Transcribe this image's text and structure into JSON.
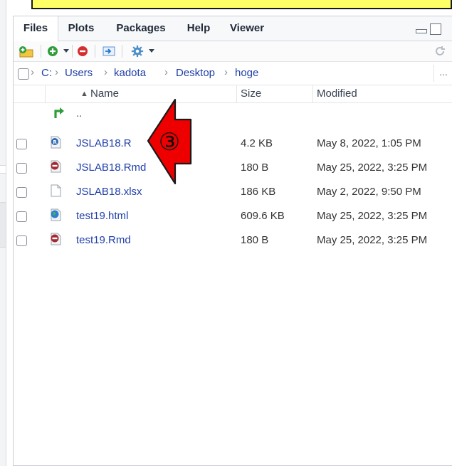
{
  "tabs": [
    {
      "label": "Files",
      "active": true
    },
    {
      "label": "Plots",
      "active": false
    },
    {
      "label": "Packages",
      "active": false
    },
    {
      "label": "Help",
      "active": false
    },
    {
      "label": "Viewer",
      "active": false
    }
  ],
  "toolbar": {
    "icons": [
      "new-folder-icon",
      "new-blank-file-icon",
      "delete-icon",
      "rename-icon",
      "more-gear-icon",
      "refresh-icon"
    ]
  },
  "breadcrumb": [
    "C:",
    "Users",
    "kadota",
    "Desktop",
    "hoge"
  ],
  "breadcrumb_more": "...",
  "columns": {
    "name": "Name",
    "size": "Size",
    "modified": "Modified",
    "sort_indicator": "▲"
  },
  "parent_dir_label": "..",
  "files": [
    {
      "name": "JSLAB18.R",
      "size": "4.2 KB",
      "modified": "May 8, 2022, 1:05 PM",
      "icon": "r-script-icon"
    },
    {
      "name": "JSLAB18.Rmd",
      "size": "180 B",
      "modified": "May 25, 2022, 3:25 PM",
      "icon": "rmarkdown-icon"
    },
    {
      "name": "JSLAB18.xlsx",
      "size": "186 KB",
      "modified": "May 2, 2022, 9:50 PM",
      "icon": "blank-file-icon"
    },
    {
      "name": "test19.html",
      "size": "609.6 KB",
      "modified": "May 25, 2022, 3:25 PM",
      "icon": "html-globe-icon"
    },
    {
      "name": "test19.Rmd",
      "size": "180 B",
      "modified": "May 25, 2022, 3:25 PM",
      "icon": "rmarkdown-icon"
    }
  ],
  "annotation": {
    "label": "③",
    "color": "#ee0000"
  },
  "colors": {
    "link": "#1f3fa8",
    "banner": "#ffff66",
    "parent_arrow": "#2e9d3a"
  }
}
